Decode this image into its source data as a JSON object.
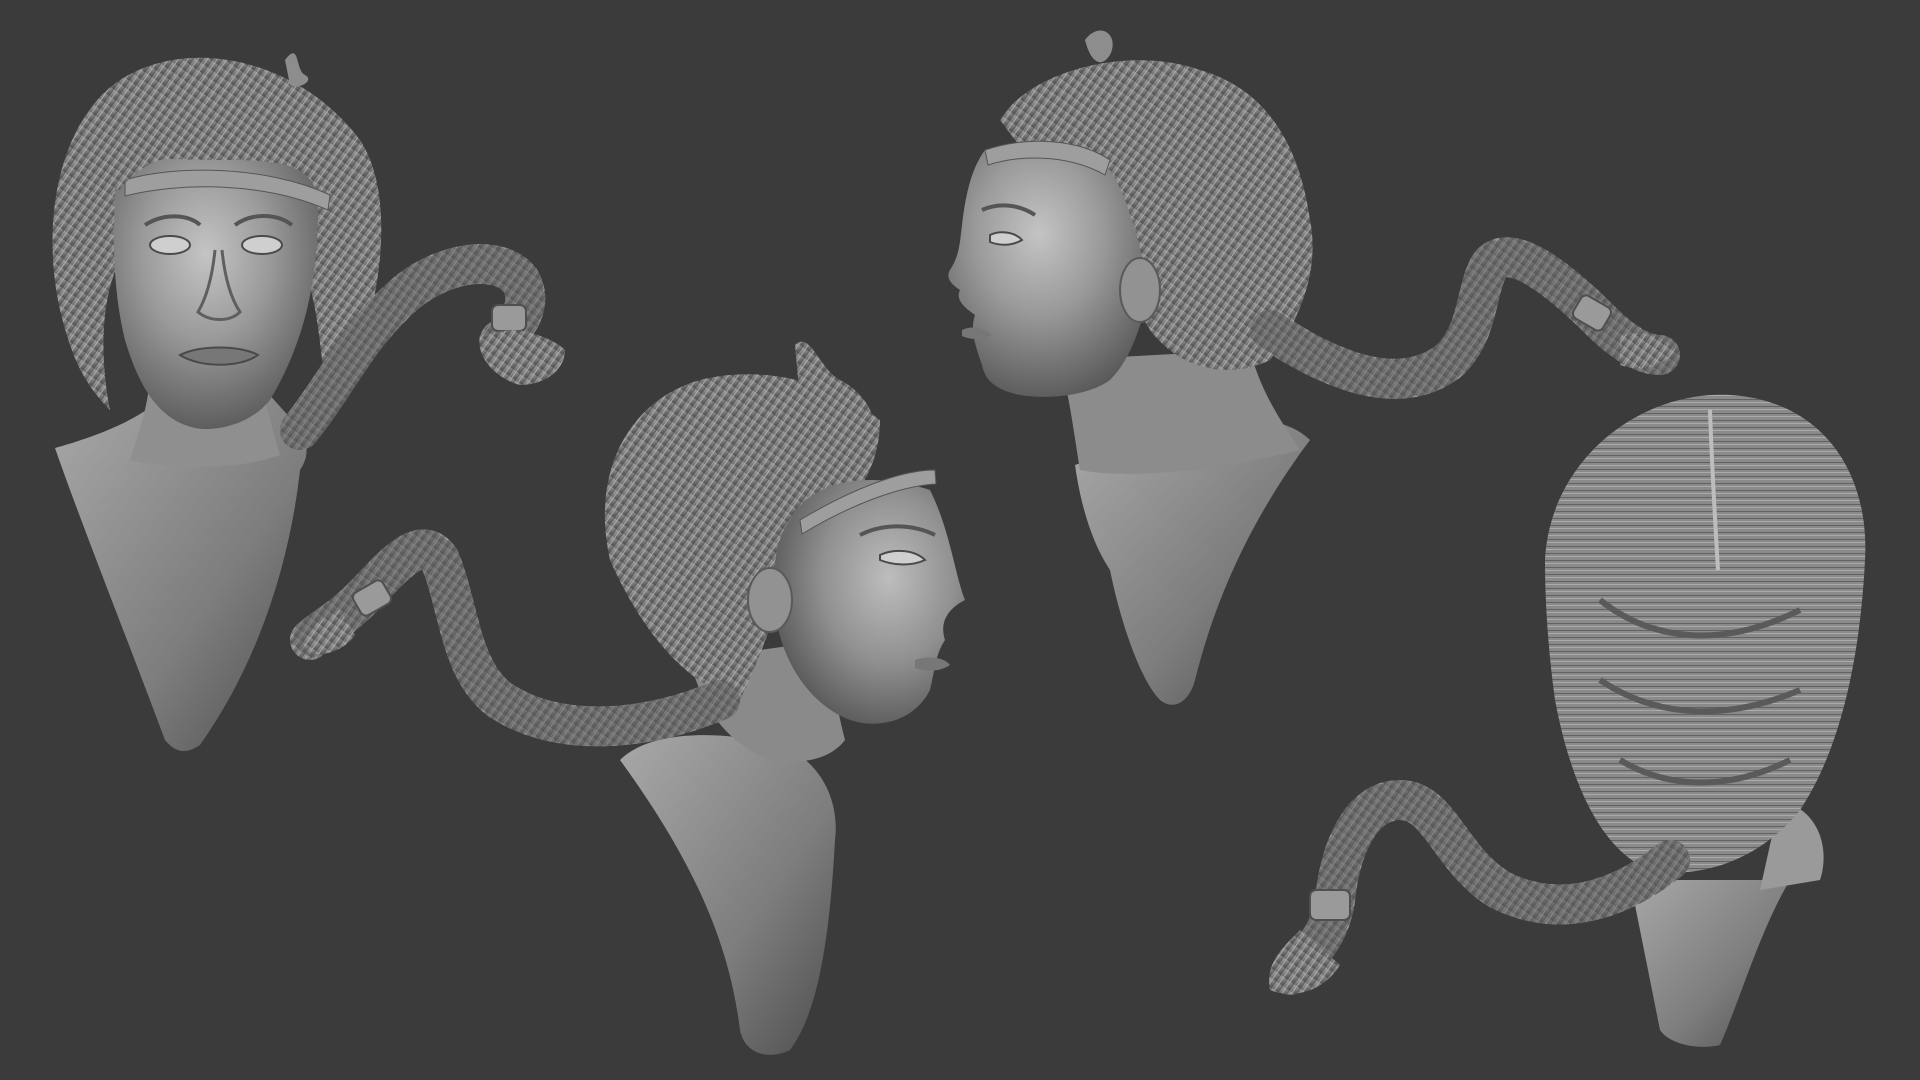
{
  "scene": {
    "background_color": "#3b3b3b",
    "clay_base_color": "#8a8a8a",
    "clay_highlight_color": "#c9c9c9",
    "clay_shadow_color": "#4a4a4a",
    "views": [
      {
        "name": "front-view",
        "icon": "sculpt-bust-front"
      },
      {
        "name": "three-quarter-right-view",
        "icon": "sculpt-bust-three-quarter"
      },
      {
        "name": "left-profile-view",
        "icon": "sculpt-bust-profile"
      },
      {
        "name": "back-view",
        "icon": "sculpt-bust-back"
      }
    ]
  }
}
